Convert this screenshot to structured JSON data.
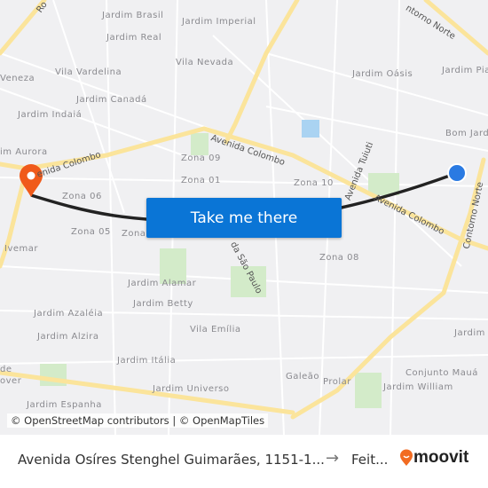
{
  "map": {
    "neighborhoods": [
      {
        "name": "Jardim Brasil"
      },
      {
        "name": "Jardim Imperial"
      },
      {
        "name": "Jardim Real"
      },
      {
        "name": "Vila Nevada"
      },
      {
        "name": "Vila Vardelina"
      },
      {
        "name": "Veneza"
      },
      {
        "name": "Jardim Canadá"
      },
      {
        "name": "Jardim Indaiá"
      },
      {
        "name": "im Aurora"
      },
      {
        "name": "Zona 09"
      },
      {
        "name": "Zona 01"
      },
      {
        "name": "Zona 06"
      },
      {
        "name": "Zona 05"
      },
      {
        "name": "Zona"
      },
      {
        "name": "Ivemar"
      },
      {
        "name": "Jardim Oásis"
      },
      {
        "name": "Jardim Pia"
      },
      {
        "name": "Bom Jard"
      },
      {
        "name": "Zona 10"
      },
      {
        "name": "Zona 08"
      },
      {
        "name": "Jardim Alamar"
      },
      {
        "name": "Jardim Betty"
      },
      {
        "name": "Jardim Azaléia"
      },
      {
        "name": "Jardim Alzira"
      },
      {
        "name": "Vila Emília"
      },
      {
        "name": "Jardim Itália"
      },
      {
        "name": "Jardim Universo"
      },
      {
        "name": "Galeão"
      },
      {
        "name": "Prolar"
      },
      {
        "name": "Conjunto Mauá"
      },
      {
        "name": "Jardim William"
      },
      {
        "name": "Jardim"
      },
      {
        "name": "Jardim Espanha"
      },
      {
        "name": "de"
      },
      {
        "name": "over"
      }
    ],
    "roads": [
      {
        "name": "Avenida Colombo"
      },
      {
        "name": "enida Colombo"
      },
      {
        "name": "Avenida Colombo"
      },
      {
        "name": "Avenida Tuiuti"
      },
      {
        "name": "da São Paulo"
      },
      {
        "name": "Contorno Norte"
      },
      {
        "name": "ntorno Norte"
      },
      {
        "name": "Ro"
      }
    ],
    "colors": {
      "origin": "#2a7ae2",
      "destination": "#f05a1a",
      "route": "#222222",
      "major_road": "#fbe49b",
      "park": "#d3ebc9"
    }
  },
  "cta": {
    "label": "Take me there"
  },
  "attribution": "© OpenStreetMap contributors | © OpenMapTiles",
  "footer": {
    "origin": "Avenida Osíres Stenghel Guimarães, 1151-1...",
    "arrow": "→",
    "destination": "Feit...",
    "brand": "moovit",
    "brand_color": "#f26b21"
  }
}
